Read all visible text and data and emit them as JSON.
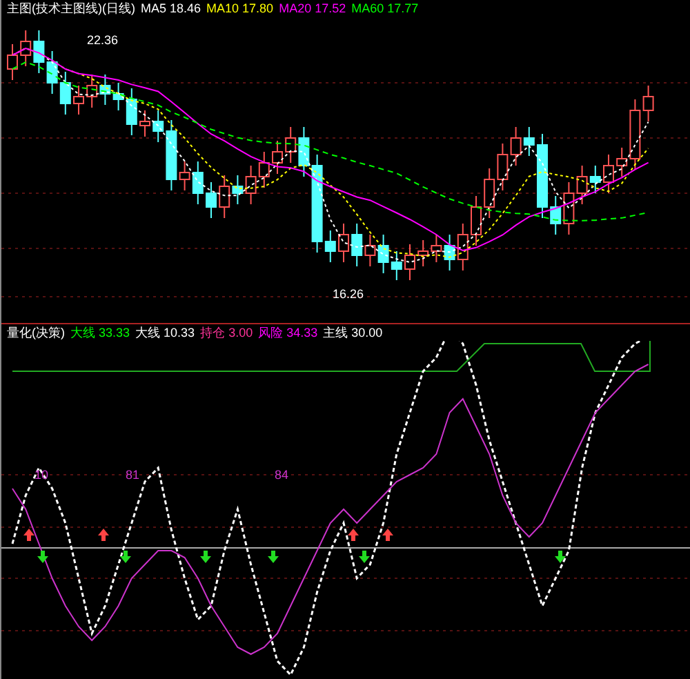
{
  "main_chart": {
    "title": "主图(技术主图线)(日线)",
    "readings": [
      {
        "label": "MA5 18.46",
        "color": "#ffffff"
      },
      {
        "label": "MA10 17.80",
        "color": "#ffff00"
      },
      {
        "label": "MA20 17.52",
        "color": "#ff00ff"
      },
      {
        "label": "MA60 17.77",
        "color": "#00ff00"
      }
    ],
    "high_label": "22.36",
    "low_label": "16.26"
  },
  "indicator": {
    "title": "量化(决策)",
    "readings": [
      {
        "label": "大线 33.33",
        "color": "#00ff00"
      },
      {
        "label": "大线 10.33",
        "color": "#ffffff"
      },
      {
        "label": "持仓 3.00",
        "color": "#ff3399"
      },
      {
        "label": "风险 34.33",
        "color": "#ff00ff"
      },
      {
        "label": "主线 30.00",
        "color": "#ffffff"
      }
    ],
    "labels": [
      "10",
      "81",
      "84"
    ]
  }
}
